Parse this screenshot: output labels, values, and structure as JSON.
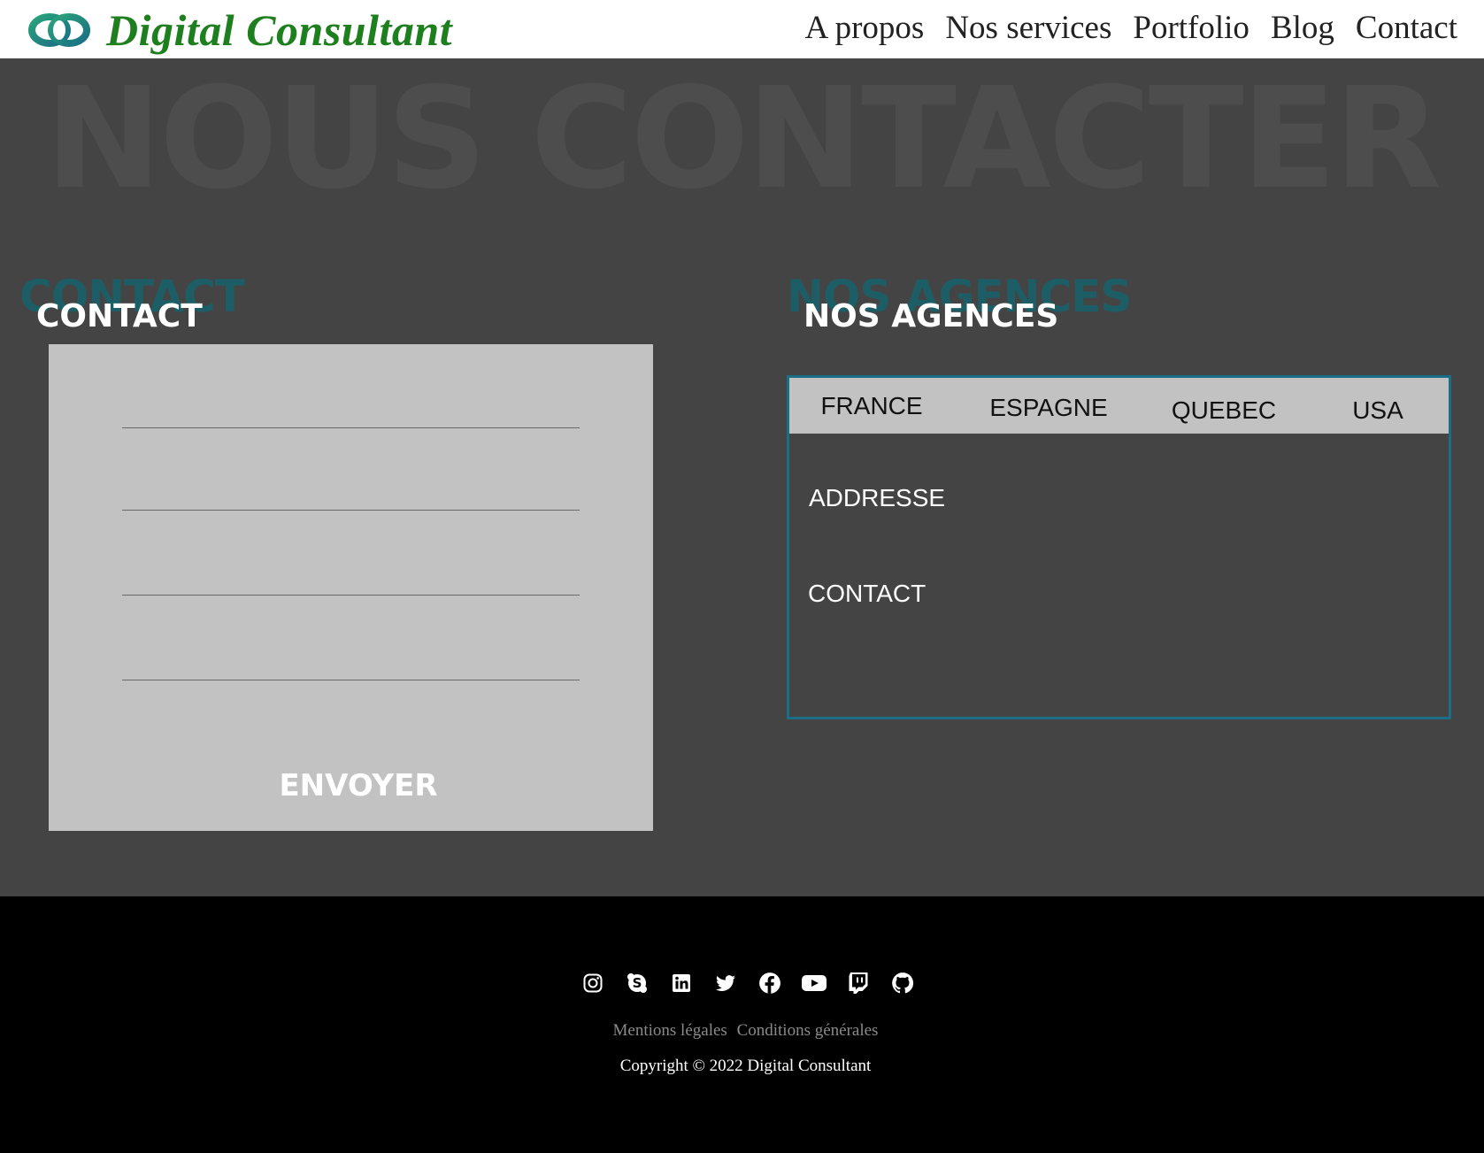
{
  "header": {
    "logo_text": "Digital Consultant",
    "nav": [
      {
        "label": "A propos"
      },
      {
        "label": "Nos services"
      },
      {
        "label": "Portfolio"
      },
      {
        "label": "Blog"
      },
      {
        "label": "Contact"
      }
    ]
  },
  "hero": {
    "title": "NOUS CONTACTER"
  },
  "contact": {
    "ghost_title": "CONTACT",
    "title": "CONTACT",
    "fields": [
      {
        "value": "",
        "placeholder": ""
      },
      {
        "value": "",
        "placeholder": ""
      },
      {
        "value": "",
        "placeholder": ""
      },
      {
        "value": "",
        "placeholder": ""
      }
    ],
    "submit_label": "ENVOYER"
  },
  "agencies": {
    "ghost_title": "NOS AGENCES",
    "title": "NOS AGENCES",
    "tabs": [
      {
        "label": "FRANCE"
      },
      {
        "label": "ESPAGNE"
      },
      {
        "label": "QUEBEC"
      },
      {
        "label": "USA"
      }
    ],
    "address_label": "ADDRESSE",
    "contact_label": "CONTACT"
  },
  "footer": {
    "socials": [
      {
        "icon": "instagram-icon"
      },
      {
        "icon": "skype-icon"
      },
      {
        "icon": "linkedin-icon"
      },
      {
        "icon": "twitter-icon"
      },
      {
        "icon": "facebook-icon"
      },
      {
        "icon": "youtube-icon"
      },
      {
        "icon": "twitch-icon"
      },
      {
        "icon": "github-icon"
      }
    ],
    "legal_notice": "Mentions légales",
    "terms": "Conditions générales",
    "copyright": "Copyright © 2022 Digital Consultant"
  },
  "colors": {
    "brand_green": "#1e7f1e",
    "accent_teal": "#1a6e85",
    "main_bg": "#444444",
    "panel_grey": "#c2c2c2"
  }
}
